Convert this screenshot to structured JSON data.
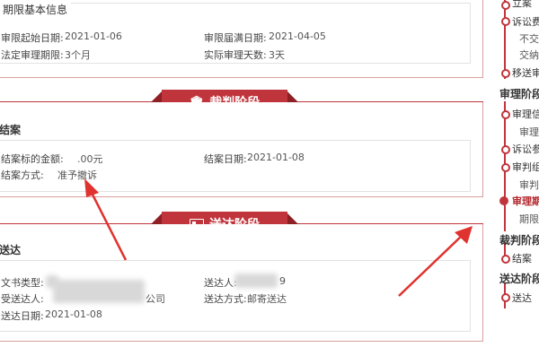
{
  "limit_info": {
    "section_title": "期限基本信息",
    "start_label": "审限起始日期:",
    "start_value": "2021-01-06",
    "end_label": "审限届满日期:",
    "end_value": "2021-04-05",
    "legal_label": "法定审理期限:",
    "legal_value": "3个月",
    "actual_label": "实际审理天数:",
    "actual_value": "3天"
  },
  "judgment_banner": {
    "title": "裁判阶段"
  },
  "closing": {
    "title": "结案",
    "amount_label": "结案标的金额:",
    "amount_value": ".00元",
    "date_label": "结案日期:",
    "date_value": "2021-01-08",
    "method_label": "结案方式:",
    "method_value": "准予撤诉"
  },
  "delivery_banner": {
    "title": "送达阶段"
  },
  "delivery": {
    "title": "送达",
    "doc_type_label": "文书类型:",
    "sender_label": "送达人:",
    "sender_value_tail": "9",
    "recipient_label": "受送达人:",
    "recipient_value_tail": "公司",
    "method_label": "送达方式:",
    "method_value": "邮寄送达",
    "date_label": "送达日期:",
    "date_value": "2021-01-08"
  },
  "timeline": {
    "items": [
      {
        "label": "立案",
        "kind": "item"
      },
      {
        "label": "诉讼费",
        "kind": "item"
      },
      {
        "label": "不交费",
        "kind": "sub"
      },
      {
        "label": "交纳的",
        "kind": "sub"
      },
      {
        "label": "移送审",
        "kind": "item"
      },
      {
        "label": "审理阶段",
        "kind": "head"
      },
      {
        "label": "审理信",
        "kind": "item"
      },
      {
        "label": "审理a",
        "kind": "sub"
      },
      {
        "label": "诉讼参",
        "kind": "item"
      },
      {
        "label": "审判组",
        "kind": "item"
      },
      {
        "label": "审判l",
        "kind": "sub"
      },
      {
        "label": "审理期",
        "kind": "active"
      },
      {
        "label": "期限a",
        "kind": "sub"
      },
      {
        "label": "裁判阶段",
        "kind": "head"
      },
      {
        "label": "结案",
        "kind": "item"
      },
      {
        "label": "送达阶段",
        "kind": "head"
      },
      {
        "label": "送达",
        "kind": "item"
      }
    ]
  },
  "colors": {
    "accent": "#c0353b",
    "card_border": "#d9a0a0",
    "arrow": "#e0322e"
  },
  "icons": {
    "judgment": "courthouse-icon",
    "delivery": "envelope-card-icon"
  }
}
